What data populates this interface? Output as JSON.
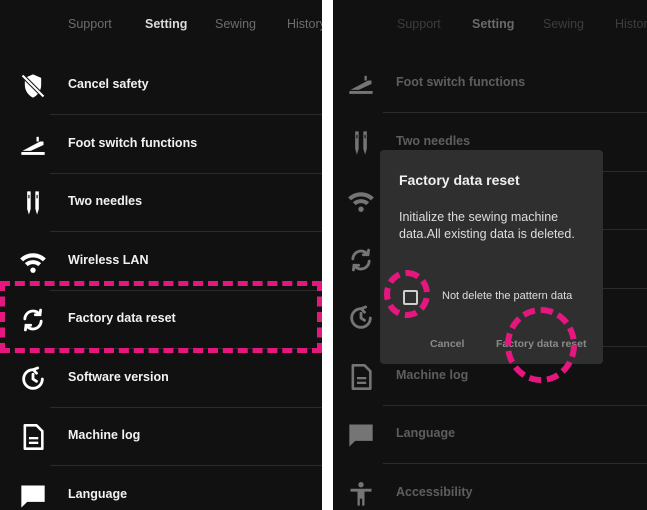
{
  "left_screen": {
    "tabs": [
      "Support",
      "Setting",
      "Sewing",
      "History"
    ],
    "menu": [
      {
        "label": "Cancel safety",
        "icon": "shield-off-icon"
      },
      {
        "label": "Foot switch functions",
        "icon": "foot-switch-icon"
      },
      {
        "label": "Two needles",
        "icon": "two-needles-icon"
      },
      {
        "label": "Wireless LAN",
        "icon": "wifi-icon"
      },
      {
        "label": "Factory data reset",
        "icon": "reset-arrows-icon"
      },
      {
        "label": "Software version",
        "icon": "software-version-icon"
      },
      {
        "label": "Machine log",
        "icon": "document-icon"
      },
      {
        "label": "Language",
        "icon": "chat-bubble-icon"
      }
    ]
  },
  "right_screen": {
    "tabs": [
      "Support",
      "Setting",
      "Sewing",
      "History"
    ],
    "menu": [
      {
        "label": "Foot switch functions",
        "icon": "foot-switch-icon"
      },
      {
        "label": "Two needles",
        "icon": "two-needles-icon"
      },
      {
        "label": "",
        "icon": "wifi-icon"
      },
      {
        "label": "",
        "icon": "reset-arrows-icon"
      },
      {
        "label": "",
        "icon": "software-version-icon"
      },
      {
        "label": "Machine log",
        "icon": "document-icon"
      },
      {
        "label": "Language",
        "icon": "chat-bubble-icon"
      },
      {
        "label": "Accessibility",
        "icon": "accessibility-icon"
      }
    ],
    "dialog": {
      "title": "Factory data reset",
      "message": "Initialize the sewing machine data.All existing data is deleted.",
      "checkbox_label": "Not delete the pattern data",
      "checkbox_checked": false,
      "cancel_label": "Cancel",
      "confirm_label": "Factory data reset"
    }
  },
  "colors": {
    "background": "#111111",
    "highlight": "#e5177f",
    "dialog_background": "#2f2f2f"
  }
}
